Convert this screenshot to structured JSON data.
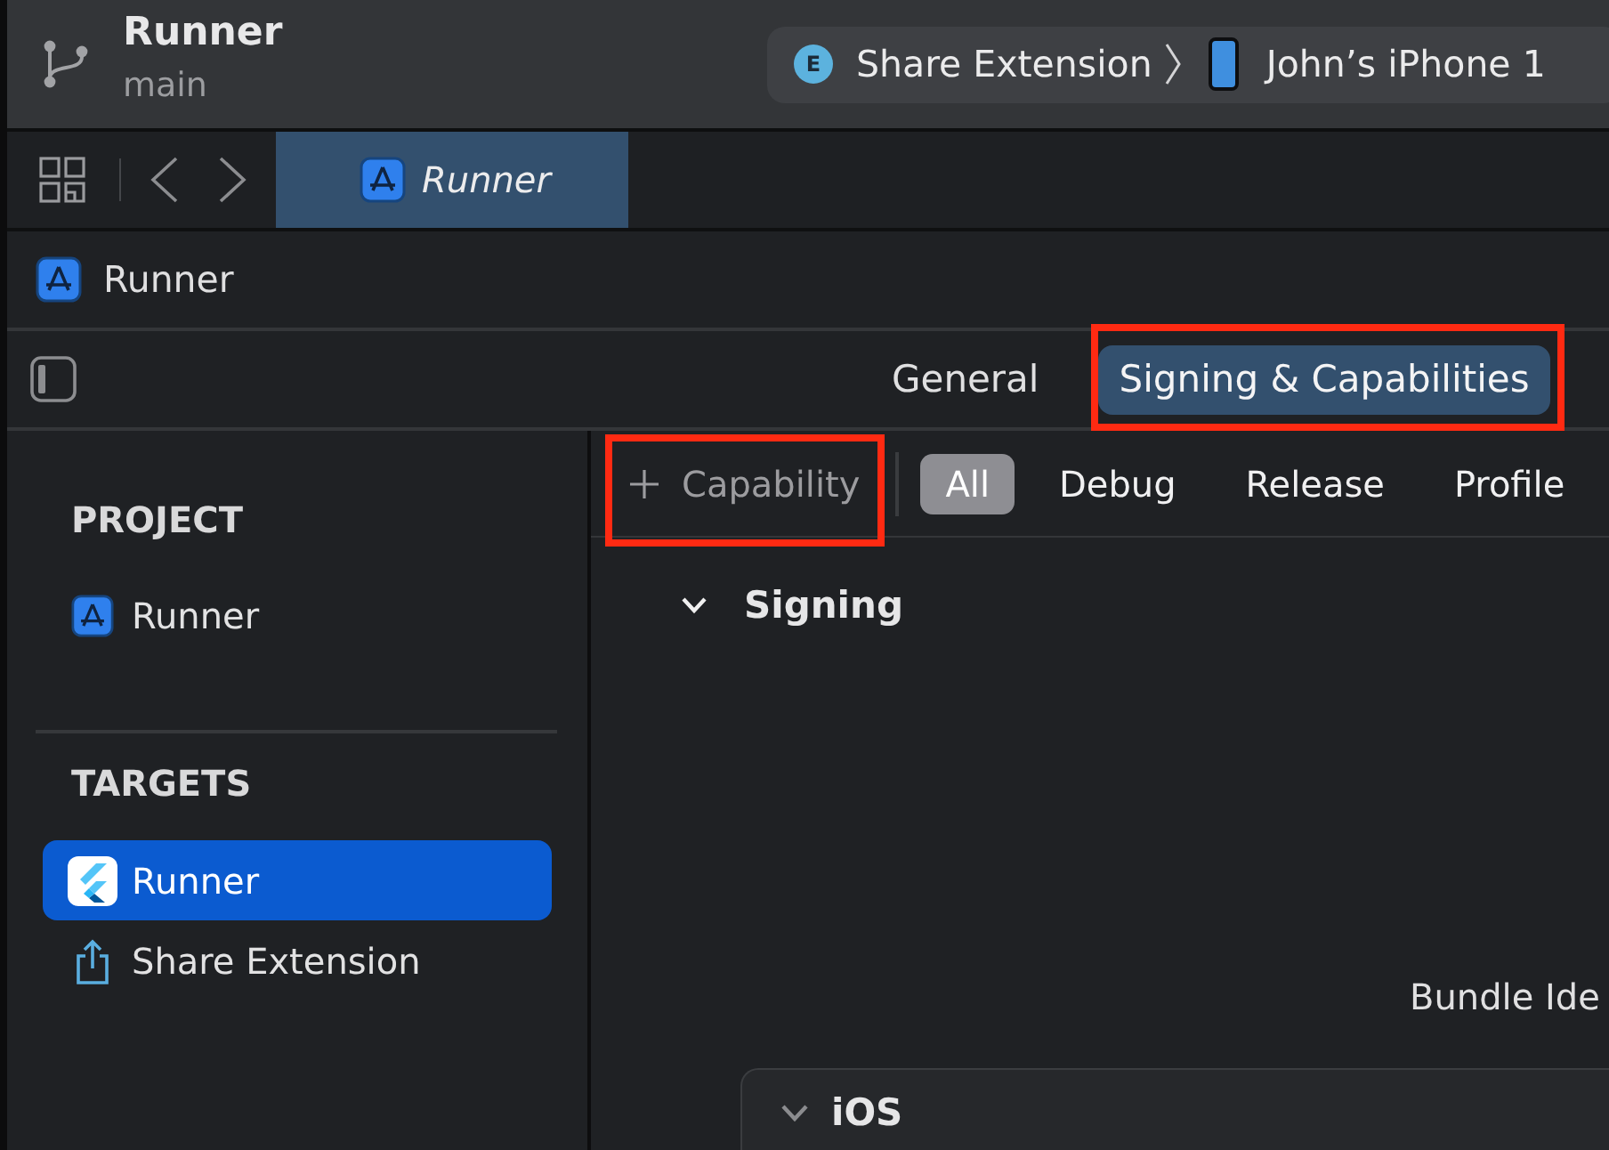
{
  "toolbar": {
    "project": "Runner",
    "branch": "main",
    "scheme": {
      "badge": "E",
      "target": "Share Extension",
      "device": "John’s iPhone 1"
    }
  },
  "tab_bar": {
    "tabs": [
      {
        "label": "Runner",
        "selected": true
      }
    ]
  },
  "breadcrumb": {
    "label": "Runner"
  },
  "editor_tabs": [
    {
      "label": "General",
      "selected": false,
      "highlighted": false
    },
    {
      "label": "Signing & Capabilities",
      "selected": true,
      "highlighted": true
    }
  ],
  "sidebar": {
    "sections": [
      {
        "title": "PROJECT",
        "items": [
          {
            "label": "Runner",
            "kind": "project",
            "selected": false
          }
        ]
      },
      {
        "title": "TARGETS",
        "items": [
          {
            "label": "Runner",
            "kind": "app",
            "selected": true
          },
          {
            "label": "Share Extension",
            "kind": "extension",
            "selected": false
          }
        ]
      }
    ]
  },
  "capability_button": {
    "label": "Capability",
    "highlighted": true
  },
  "configurations": [
    {
      "label": "All",
      "selected": true
    },
    {
      "label": "Debug",
      "selected": false
    },
    {
      "label": "Release",
      "selected": false
    },
    {
      "label": "Profile",
      "selected": false
    }
  ],
  "signing": {
    "title": "Signing",
    "expanded": true,
    "fields": [
      {
        "label": "Bundle Ide"
      }
    ],
    "platforms": [
      {
        "title": "iOS",
        "expanded": true
      }
    ]
  }
}
